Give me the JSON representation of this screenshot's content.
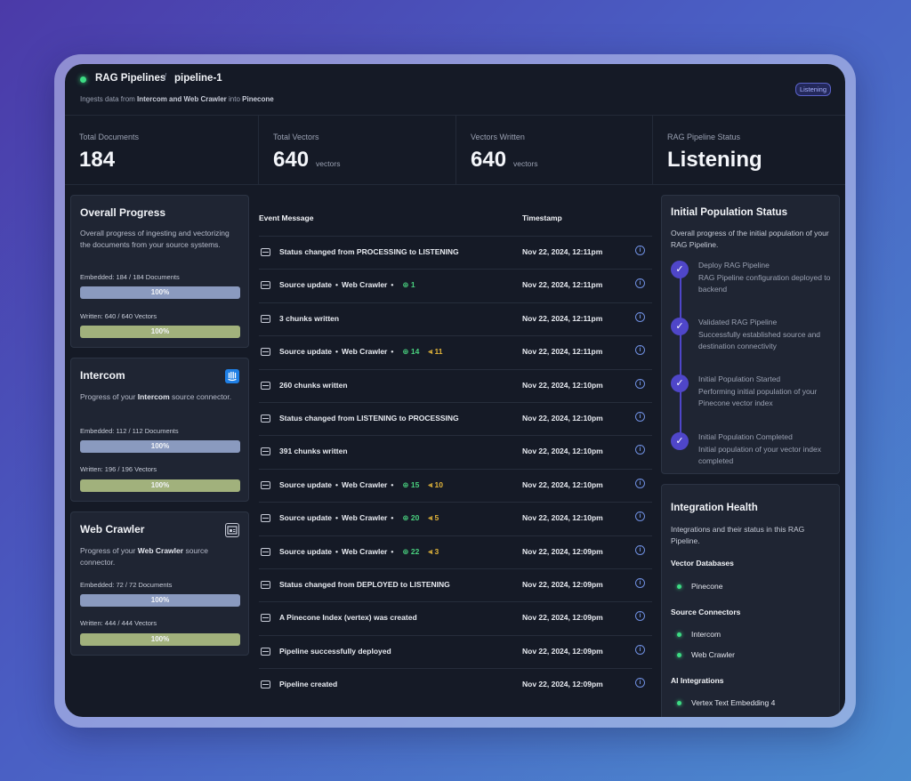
{
  "header": {
    "root": "RAG Pipelines",
    "separator": "/",
    "pipeline": "pipeline-1",
    "subtitle_pre": "Ingests data from ",
    "subtitle_sources": "Intercom and Web Crawler",
    "subtitle_mid": " into ",
    "subtitle_dest": "Pinecone",
    "badge": "Listening",
    "status_color": "#3ddc84"
  },
  "stats": [
    {
      "label": "Total Documents",
      "value": "184",
      "unit": ""
    },
    {
      "label": "Total Vectors",
      "value": "640",
      "unit": "vectors"
    },
    {
      "label": "Vectors Written",
      "value": "640",
      "unit": "vectors"
    },
    {
      "label": "RAG Pipeline Status",
      "value": "Listening",
      "unit": ""
    }
  ],
  "overall": {
    "title": "Overall Progress",
    "desc": "Overall progress of ingesting and vectorizing the documents from your source systems.",
    "embedded_label": "Embedded: 184 / 184 Documents",
    "embedded_pct": "100%",
    "embedded_fraction": 1.0,
    "written_label": "Written: 640 / 640 Vectors",
    "written_pct": "100%",
    "written_fraction": 1.0
  },
  "intercom": {
    "title": "Intercom",
    "desc_pre": "Progress of your ",
    "desc_name": "Intercom",
    "desc_post": " source connector.",
    "embedded_label": "Embedded: 112 / 112 Documents",
    "embedded_pct": "100%",
    "embedded_fraction": 1.0,
    "written_label": "Written: 196 / 196 Vectors",
    "written_pct": "100%",
    "written_fraction": 1.0,
    "icon": "intercom-logo-icon"
  },
  "webcrawler": {
    "title": "Web Crawler",
    "desc_pre": "Progress of your ",
    "desc_name": "Web Crawler",
    "desc_post": " source connector.",
    "embedded_label": "Embedded: 72 / 72 Documents",
    "embedded_pct": "100%",
    "embedded_fraction": 1.0,
    "written_label": "Written: 444 / 444 Vectors",
    "written_pct": "100%",
    "written_fraction": 1.0,
    "icon": "web-crawler-icon"
  },
  "events": {
    "col_message": "Event Message",
    "col_timestamp": "Timestamp",
    "rows": [
      {
        "message": "Status changed from PROCESSING to LISTENING",
        "ts": "Nov 22, 2024, 12:11pm"
      },
      {
        "message": "Source update",
        "source": "Web Crawler",
        "added": "1",
        "ts": "Nov 22, 2024, 12:11pm"
      },
      {
        "message": "3 chunks written",
        "ts": "Nov 22, 2024, 12:11pm"
      },
      {
        "message": "Source update",
        "source": "Web Crawler",
        "added": "14",
        "updated": "11",
        "ts": "Nov 22, 2024, 12:11pm"
      },
      {
        "message": "260 chunks written",
        "ts": "Nov 22, 2024, 12:10pm"
      },
      {
        "message": "Status changed from LISTENING to PROCESSING",
        "ts": "Nov 22, 2024, 12:10pm"
      },
      {
        "message": "391 chunks written",
        "ts": "Nov 22, 2024, 12:10pm"
      },
      {
        "message": "Source update",
        "source": "Web Crawler",
        "added": "15",
        "updated": "10",
        "ts": "Nov 22, 2024, 12:10pm"
      },
      {
        "message": "Source update",
        "source": "Web Crawler",
        "added": "20",
        "updated": "5",
        "ts": "Nov 22, 2024, 12:10pm"
      },
      {
        "message": "Source update",
        "source": "Web Crawler",
        "added": "22",
        "updated": "3",
        "ts": "Nov 22, 2024, 12:09pm"
      },
      {
        "message": "Status changed from DEPLOYED to LISTENING",
        "ts": "Nov 22, 2024, 12:09pm"
      },
      {
        "message": "A Pinecone Index (vertex) was created",
        "ts": "Nov 22, 2024, 12:09pm"
      },
      {
        "message": "Pipeline successfully deployed",
        "ts": "Nov 22, 2024, 12:09pm"
      },
      {
        "message": "Pipeline created",
        "ts": "Nov 22, 2024, 12:09pm"
      }
    ]
  },
  "population": {
    "title": "Initial Population Status",
    "desc": "Overall progress of the initial population of your RAG Pipeline.",
    "steps": [
      {
        "title": "Deploy RAG Pipeline",
        "body": "RAG Pipeline configuration deployed to backend"
      },
      {
        "title": "Validated RAG Pipeline",
        "body": "Successfully established source and destination connectivity"
      },
      {
        "title": "Initial Population Started",
        "body": "Performing initial population of your Pinecone vector index"
      },
      {
        "title": "Initial Population Completed",
        "body": "Initial population of your vector index completed"
      }
    ]
  },
  "health": {
    "title": "Integration Health",
    "desc": "Integrations and their status in this RAG Pipeline.",
    "groups": [
      {
        "title": "Vector Databases",
        "items": [
          "Pinecone"
        ]
      },
      {
        "title": "Source Connectors",
        "items": [
          "Intercom",
          "Web Crawler"
        ]
      },
      {
        "title": "AI Integrations",
        "items": [
          "Vertex Text Embedding 4"
        ]
      }
    ]
  },
  "colors": {
    "accent": "#4f46c9",
    "healthy": "#3ddc84",
    "added": "#49d17f",
    "updated": "#e2b53a",
    "info": "#6f8fe0"
  }
}
